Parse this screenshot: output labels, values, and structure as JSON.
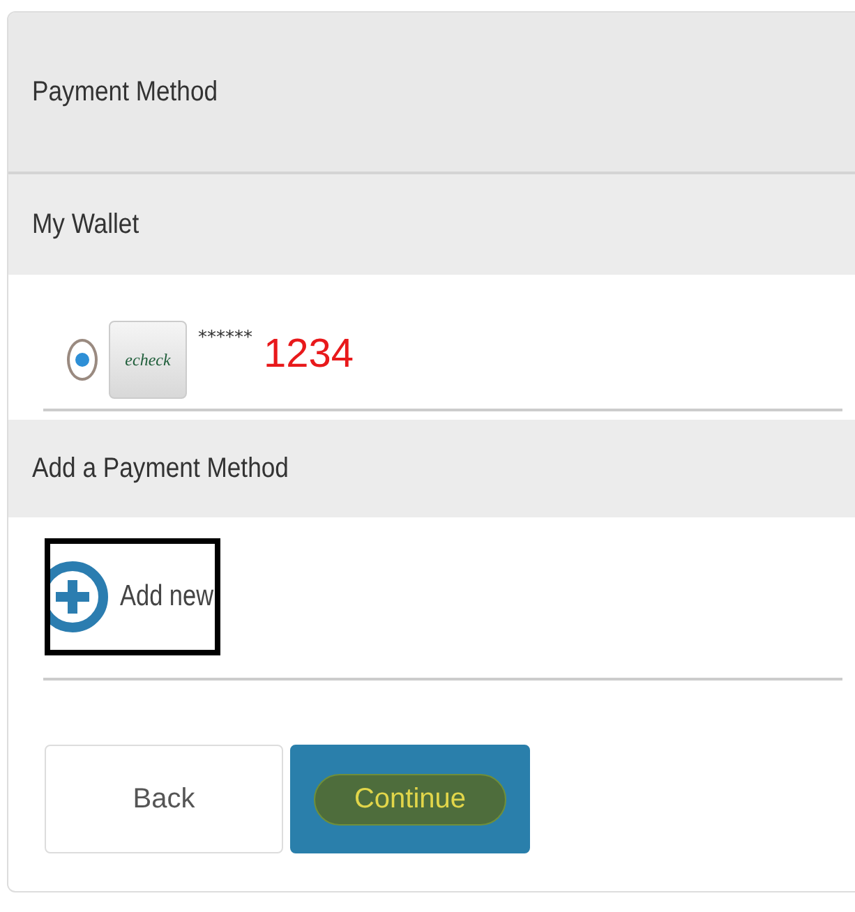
{
  "title": "Payment Method",
  "wallet": {
    "heading": "My Wallet",
    "items": [
      {
        "selected": true,
        "logo_text": "echeck",
        "masked": "******",
        "last_digits": "1234"
      }
    ]
  },
  "add_section": {
    "heading": "Add a Payment Method",
    "add_label": "Add new"
  },
  "buttons": [
    {
      "kind": "secondary",
      "label": "Back"
    },
    {
      "kind": "primary",
      "label": "Continue"
    }
  ]
}
